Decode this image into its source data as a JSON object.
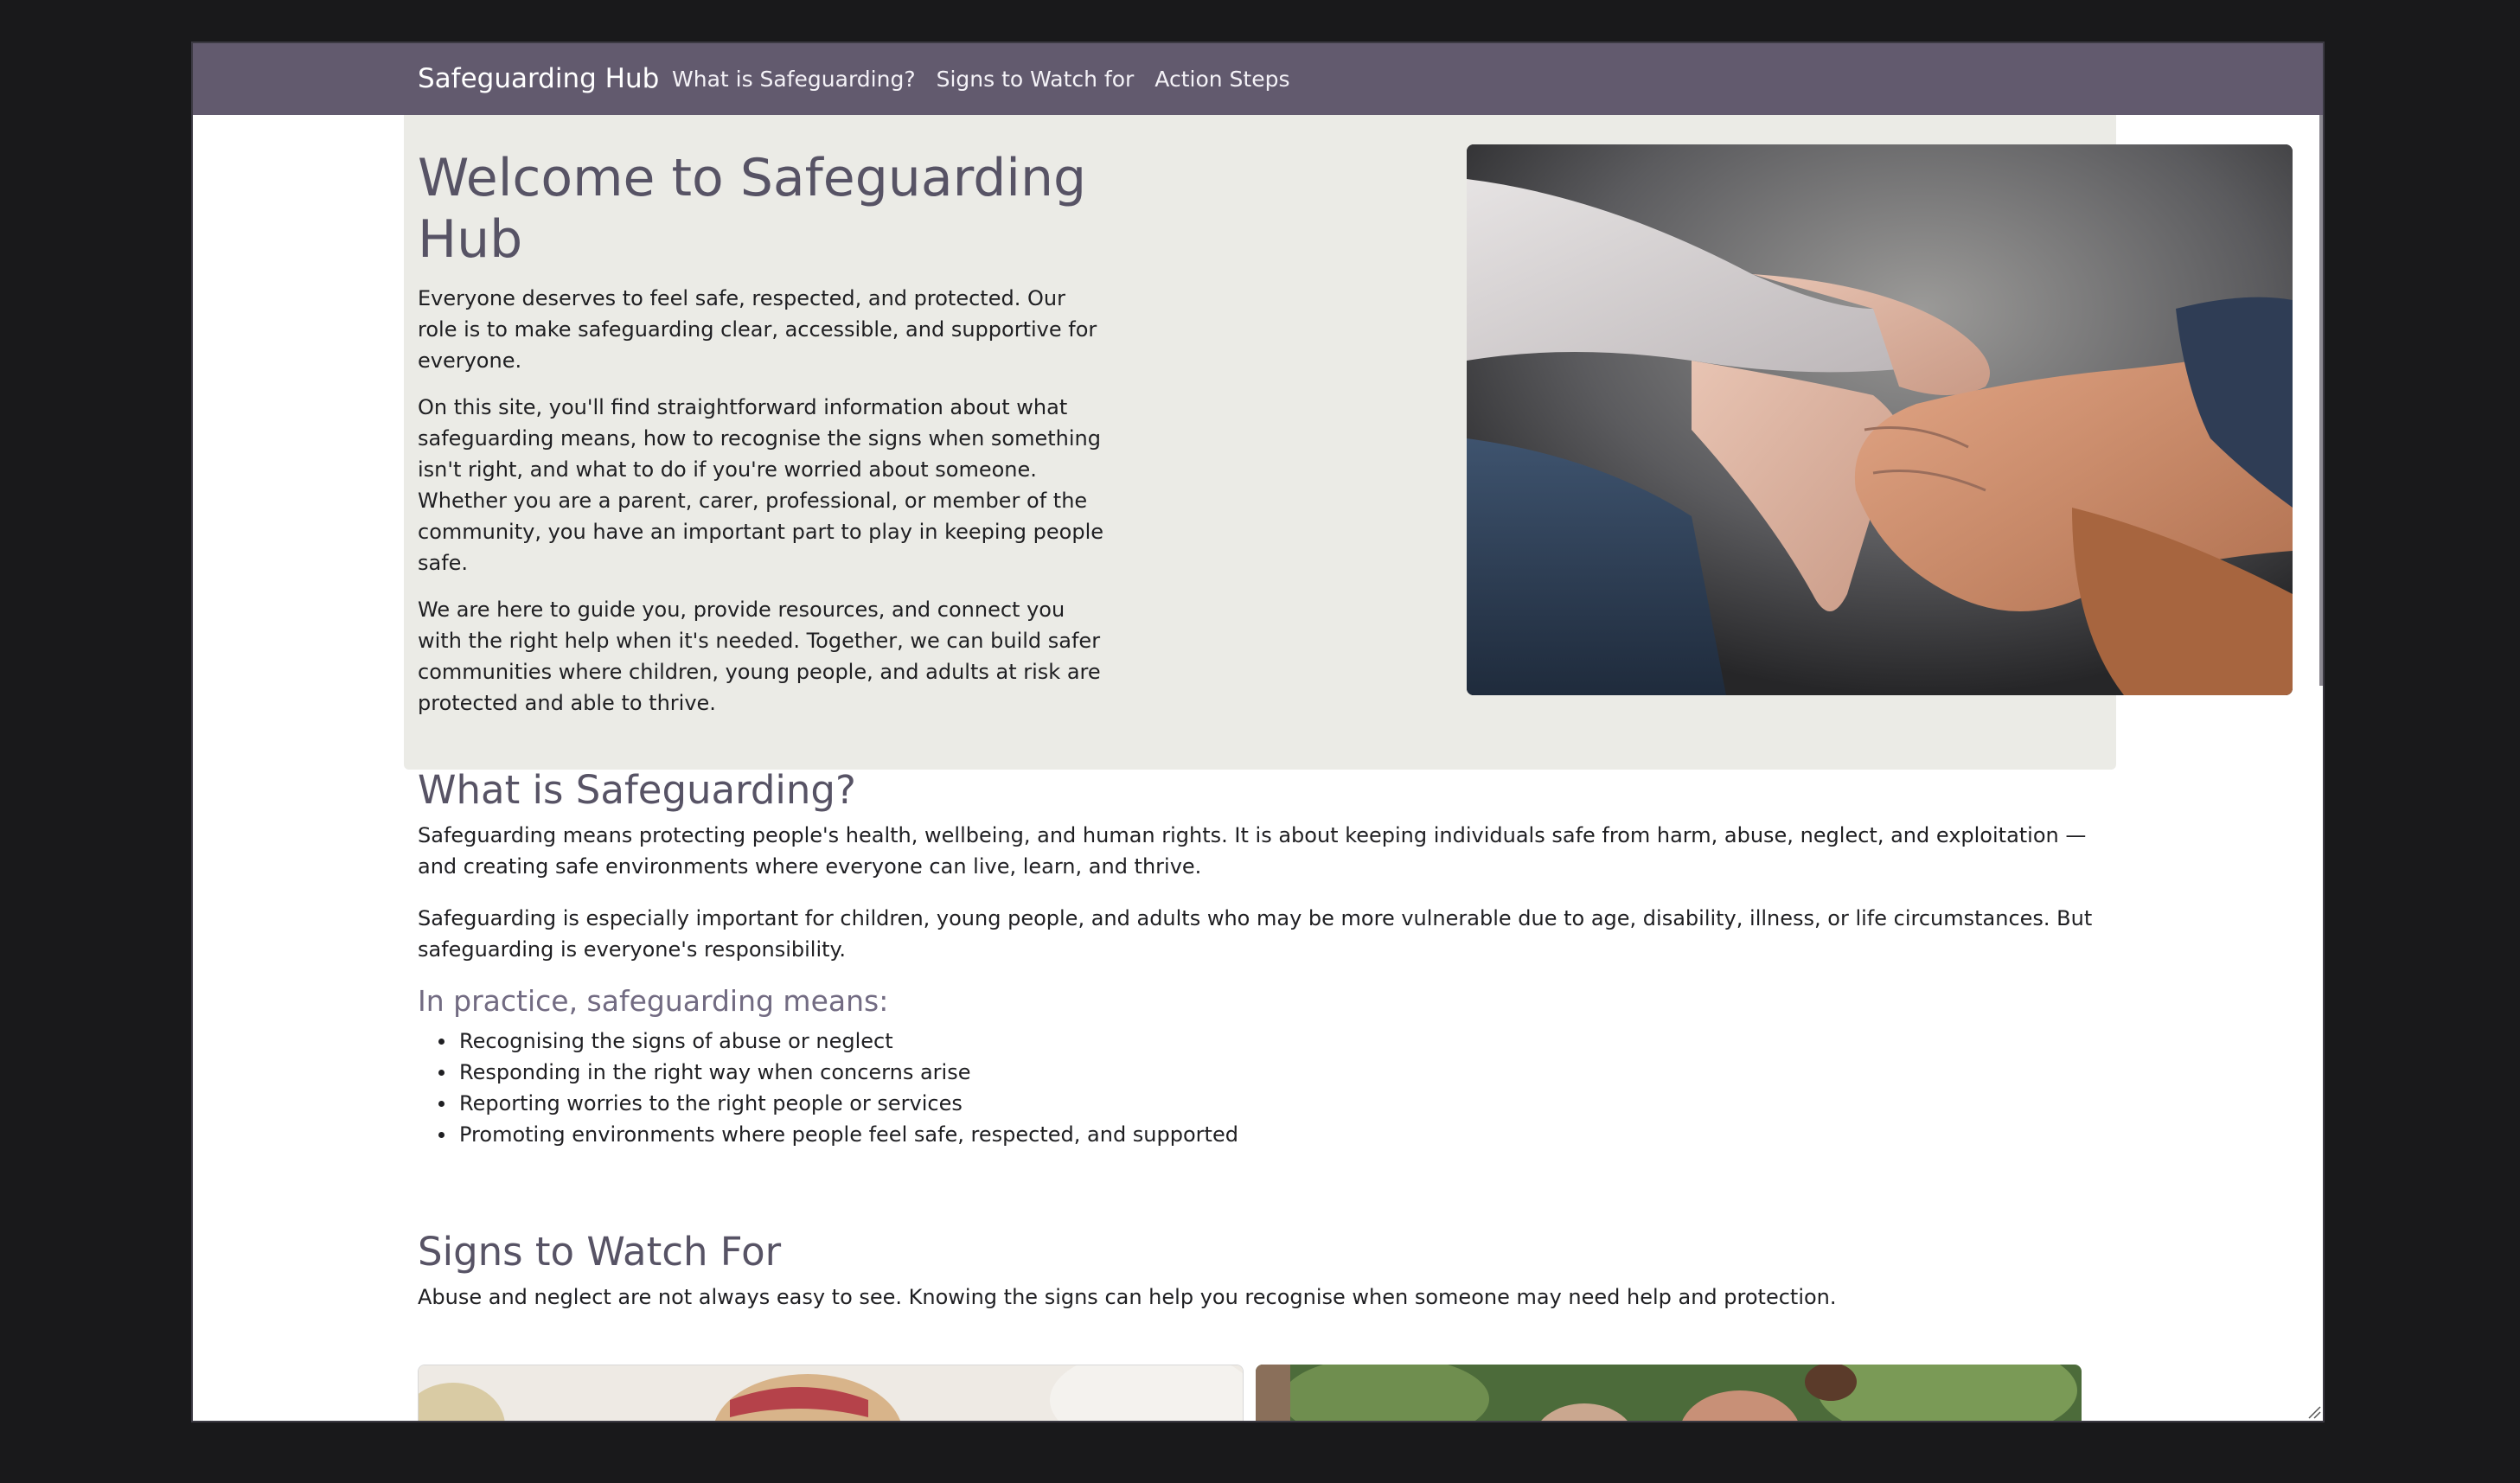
{
  "navbar": {
    "brand": "Safeguarding Hub",
    "links": [
      "What is Safeguarding?",
      "Signs to Watch for",
      "Action Steps"
    ]
  },
  "hero": {
    "title": "Welcome to Safeguarding Hub",
    "paragraphs": [
      "Everyone deserves to feel safe, respected, and protected. Our role is to make safeguarding clear, accessible, and supportive for everyone.",
      "On this site, you'll find straightforward information about what safeguarding means, how to recognise the signs when something isn't right, and what to do if you're worried about someone. Whether you are a parent, carer, professional, or member of the community, you have an important part to play in keeping people safe.",
      "We are here to guide you, provide resources, and connect you with the right help when it's needed. Together, we can build safer communities where children, young people, and adults at risk are protected and able to thrive."
    ]
  },
  "what_is": {
    "heading": "What is Safeguarding?",
    "paragraphs": [
      "Safeguarding means protecting people's health, wellbeing, and human rights. It is about keeping individuals safe from harm, abuse, neglect, and exploitation — and creating safe environments where everyone can live, learn, and thrive.",
      "Safeguarding is especially important for children, young people, and adults who may be more vulnerable due to age, disability, illness, or life circumstances. But safeguarding is everyone's responsibility."
    ],
    "subheading": "In practice, safeguarding means:",
    "bullets": [
      "Recognising the signs of abuse or neglect",
      "Responding in the right way when concerns arise",
      "Reporting worries to the right people or services",
      "Promoting environments where people feel safe, respected, and supported"
    ]
  },
  "signs": {
    "heading": "Signs to Watch For",
    "intro": "Abuse and neglect are not always easy to see. Knowing the signs can help you recognise when someone may need help and protection."
  },
  "colors": {
    "navbar": "#625a6e",
    "hero_bg": "#ebebe6",
    "heading": "#575365",
    "subheading": "#726b82"
  }
}
